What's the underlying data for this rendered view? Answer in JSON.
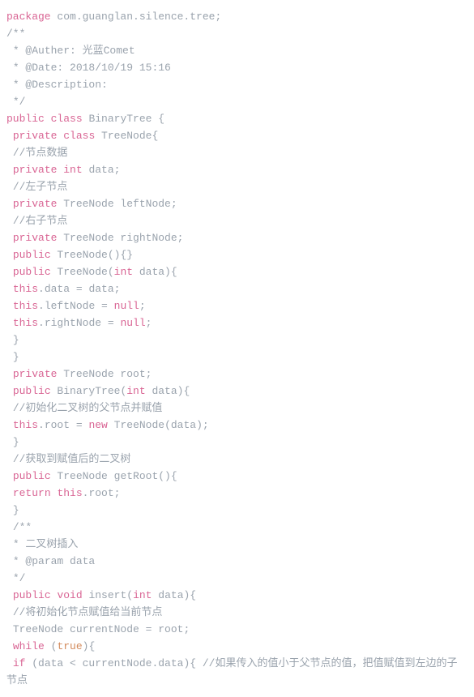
{
  "code": {
    "l1_a": "package",
    "l1_b": " com.guanglan.silence.tree;",
    "l2": "/**",
    "l3": " * @Auther: 光蓝Comet",
    "l4": " * @Date: 2018/10/19 15:16",
    "l5": " * @Description:",
    "l6": " */",
    "l7_a": "public",
    "l7_b": " ",
    "l7_c": "class",
    "l7_d": " BinaryTree {",
    "l8_a": " ",
    "l8_b": "private",
    "l8_c": " ",
    "l8_d": "class",
    "l8_e": " TreeNode{",
    "l9": " //节点数据",
    "l10_a": " ",
    "l10_b": "private",
    "l10_c": " ",
    "l10_d": "int",
    "l10_e": " data;",
    "l11": " //左子节点",
    "l12_a": " ",
    "l12_b": "private",
    "l12_c": " TreeNode leftNode;",
    "l13": " //右子节点",
    "l14_a": " ",
    "l14_b": "private",
    "l14_c": " TreeNode rightNode;",
    "l15_a": " ",
    "l15_b": "public",
    "l15_c": " TreeNode(){}",
    "l16_a": " ",
    "l16_b": "public",
    "l16_c": " TreeNode(",
    "l16_d": "int",
    "l16_e": " data){",
    "l17_a": " ",
    "l17_b": "this",
    "l17_c": ".data = data;",
    "l18_a": " ",
    "l18_b": "this",
    "l18_c": ".leftNode = ",
    "l18_d": "null",
    "l18_e": ";",
    "l19_a": " ",
    "l19_b": "this",
    "l19_c": ".rightNode = ",
    "l19_d": "null",
    "l19_e": ";",
    "l20": " }",
    "l21": " }",
    "l22_a": " ",
    "l22_b": "private",
    "l22_c": " TreeNode root;",
    "l23_a": " ",
    "l23_b": "public",
    "l23_c": " BinaryTree(",
    "l23_d": "int",
    "l23_e": " data){",
    "l24": " //初始化二叉树的父节点并赋值",
    "l25_a": " ",
    "l25_b": "this",
    "l25_c": ".root = ",
    "l25_d": "new",
    "l25_e": " TreeNode(data);",
    "l26": " }",
    "l27": " //获取到赋值后的二叉树",
    "l28_a": " ",
    "l28_b": "public",
    "l28_c": " TreeNode getRoot(){",
    "l29_a": " ",
    "l29_b": "return",
    "l29_c": " ",
    "l29_d": "this",
    "l29_e": ".root;",
    "l30": " }",
    "l31": " /**",
    "l32": " * 二叉树插入",
    "l33": " * @param data",
    "l34": " */",
    "l35_a": " ",
    "l35_b": "public",
    "l35_c": " ",
    "l35_d": "void",
    "l35_e": " insert(",
    "l35_f": "int",
    "l35_g": " data){",
    "l36": " //将初始化节点赋值给当前节点",
    "l37": " TreeNode currentNode = root;",
    "l38_a": " ",
    "l38_b": "while",
    "l38_c": " (",
    "l38_d": "true",
    "l38_e": "){",
    "l39_a": " ",
    "l39_b": "if",
    "l39_c": " (data < currentNode.data){ //如果传入的值小于父节点的值，把值赋值到左边的子节点"
  }
}
